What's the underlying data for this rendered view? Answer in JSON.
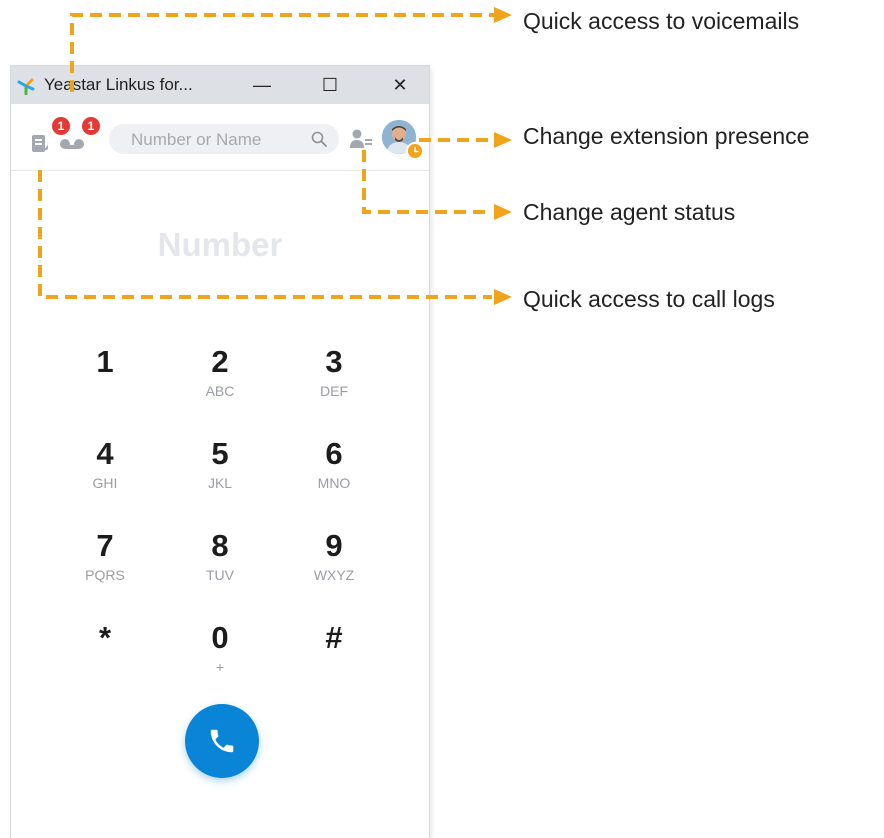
{
  "window": {
    "title": "Yeastar Linkus for...",
    "controls": {
      "minimize": "—",
      "maximize": "☐",
      "close": "✕"
    }
  },
  "toolbar": {
    "call_logs_badge": "1",
    "voicemail_badge": "1",
    "search_placeholder": "Number or Name",
    "icons": [
      "call-logs-icon",
      "voicemail-icon",
      "search-icon",
      "agent-status-icon",
      "avatar",
      "presence-icon"
    ]
  },
  "dialpad": {
    "number_placeholder": "Number",
    "keys": [
      {
        "digit": "1",
        "letters": ""
      },
      {
        "digit": "2",
        "letters": "ABC"
      },
      {
        "digit": "3",
        "letters": "DEF"
      },
      {
        "digit": "4",
        "letters": "GHI"
      },
      {
        "digit": "5",
        "letters": "JKL"
      },
      {
        "digit": "6",
        "letters": "MNO"
      },
      {
        "digit": "7",
        "letters": "PQRS"
      },
      {
        "digit": "8",
        "letters": "TUV"
      },
      {
        "digit": "9",
        "letters": "WXYZ"
      },
      {
        "digit": "*",
        "letters": ""
      },
      {
        "digit": "0",
        "letters": "+"
      },
      {
        "digit": "#",
        "letters": ""
      }
    ]
  },
  "annotations": {
    "voicemails": "Quick access to voicemails",
    "presence": "Change extension presence",
    "agent_status": "Change agent status",
    "call_logs": "Quick access to call logs"
  },
  "colors": {
    "accent": "#0a84d6",
    "badge": "#e53935",
    "presence": "#f5a11a",
    "annotation_line": "#f0a41c",
    "titlebar": "#dde1e6"
  }
}
